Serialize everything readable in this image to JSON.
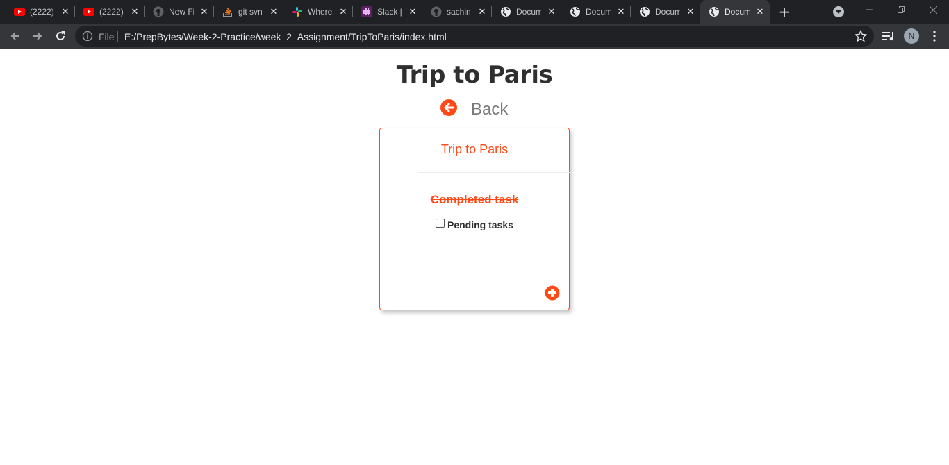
{
  "browser": {
    "tabs": [
      {
        "title": "(2222)",
        "icon": "youtube-icon",
        "active": false
      },
      {
        "title": "(2222)",
        "icon": "youtube-icon",
        "active": false
      },
      {
        "title": "New Fi",
        "icon": "github-icon",
        "active": false
      },
      {
        "title": "git svn",
        "icon": "stackoverflow-icon",
        "active": false
      },
      {
        "title": "Where",
        "icon": "slack-icon",
        "active": false
      },
      {
        "title": "Slack |",
        "icon": "slack-app-icon",
        "active": false
      },
      {
        "title": "sachin",
        "icon": "github-icon",
        "active": false
      },
      {
        "title": "Docum",
        "icon": "globe-icon",
        "active": false
      },
      {
        "title": "Docum",
        "icon": "globe-icon",
        "active": false
      },
      {
        "title": "Docum",
        "icon": "globe-icon",
        "active": false
      },
      {
        "title": "Docum",
        "icon": "globe-icon",
        "active": true
      }
    ],
    "address": {
      "scheme": "File",
      "url": "E:/PrepBytes/Week-2-Practice/week_2_Assignment/TripToParis/index.html"
    },
    "profile_initial": "N"
  },
  "page": {
    "heading": "Trip to Paris",
    "back_label": "Back",
    "card": {
      "title": "Trip to Paris",
      "completed_label": "Completed task",
      "pending_label": "Pending tasks",
      "pending_checked": false
    }
  },
  "colors": {
    "accent": "#ff4a17",
    "chrome_dark": "#202124",
    "chrome_mid": "#35363a"
  }
}
